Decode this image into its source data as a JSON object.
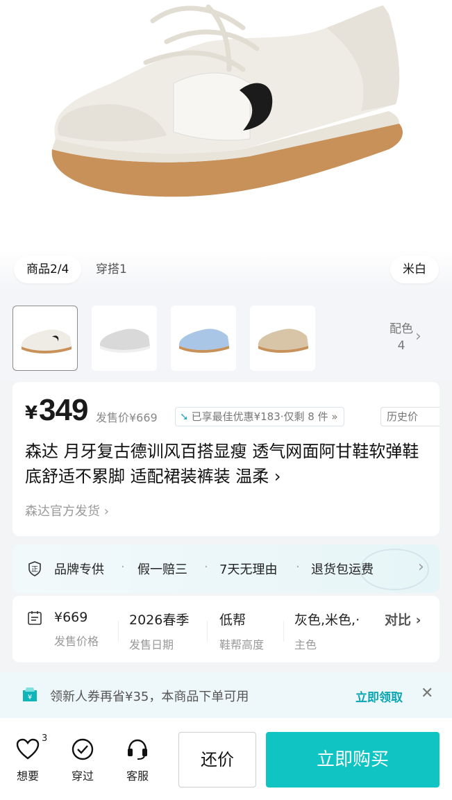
{
  "media_tabs": {
    "product_tab": "商品2/4",
    "outfit_tab": "穿搭1",
    "color_label": "米白"
  },
  "thumbnails": {
    "more_colors_label": "配色",
    "more_colors_count": "4"
  },
  "price_card": {
    "currency": "¥",
    "price": "349",
    "original_price": "发售价¥669",
    "deal_text": "已享最佳优惠¥183·仅剩 8 件 »",
    "history_label": "历史价",
    "title": "森达 月牙复古德训风百搭显瘦 透气网面阿甘鞋软弹鞋底舒适不累脚 适配裙装裤装 温柔 ›",
    "shipping": "森达官方发货 ›"
  },
  "guarantee": {
    "items": [
      "品牌专供",
      "假一赔三",
      "7天无理由",
      "退货包运费"
    ]
  },
  "specs": {
    "items": [
      {
        "value": "¥669",
        "label": "发售价格"
      },
      {
        "value": "2026春季",
        "label": "发售日期"
      },
      {
        "value": "低帮",
        "label": "鞋帮高度"
      },
      {
        "value": "灰色,米色,·",
        "label": "主色"
      }
    ],
    "compare_label": "对比 ›"
  },
  "coupon": {
    "text": "领新人券再省¥35，本商品下单可用",
    "claim_label": "立即领取",
    "close": "✕"
  },
  "bottom_bar": {
    "want_label": "想要",
    "want_count": "3",
    "worn_label": "穿过",
    "service_label": "客服",
    "bargain_label": "还价",
    "buy_label": "立即购买"
  },
  "colors": {
    "accent": "#11c4c4",
    "claim": "#0aa6b3"
  }
}
